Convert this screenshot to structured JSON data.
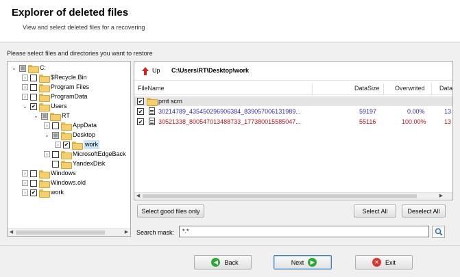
{
  "header": {
    "title": "Explorer of deleted files",
    "subtitle": "View and select deleted files for a recovering"
  },
  "instruction": "Please select files and directories you want to restore",
  "tree": {
    "items": [
      {
        "label": "C:",
        "state": "partial",
        "expander": "open"
      },
      {
        "label": "$Recycle.Bin",
        "state": "unchecked",
        "expander": "closed"
      },
      {
        "label": "Program Files",
        "state": "unchecked",
        "expander": "closed"
      },
      {
        "label": "ProgramData",
        "state": "unchecked",
        "expander": "closed"
      },
      {
        "label": "Users",
        "state": "checked",
        "expander": "open"
      },
      {
        "label": "RT",
        "state": "partial",
        "expander": "open"
      },
      {
        "label": "AppData",
        "state": "unchecked",
        "expander": "closed"
      },
      {
        "label": "Desktop",
        "state": "partial",
        "expander": "open"
      },
      {
        "label": "work",
        "state": "checked",
        "expander": "closed"
      },
      {
        "label": "MicrosoftEdgeBack",
        "state": "unchecked",
        "expander": "closed"
      },
      {
        "label": "YandexDisk",
        "state": "unchecked",
        "expander": "none"
      },
      {
        "label": "Windows",
        "state": "unchecked",
        "expander": "closed"
      },
      {
        "label": "Windows.old",
        "state": "unchecked",
        "expander": "closed"
      },
      {
        "label": "work",
        "state": "checked",
        "expander": "closed"
      }
    ]
  },
  "files": {
    "up_label": "Up",
    "path": "C:\\Users\\RT\\Desktop\\work",
    "columns": {
      "filename": "FileName",
      "datasize": "DataSize",
      "overwrited": "Overwrited",
      "date": "Data"
    },
    "rows": [
      {
        "name": "prnt scrn",
        "size": "",
        "over": "",
        "date": "",
        "type": "folder"
      },
      {
        "name": "30214789_435450296906384_839057006131989...",
        "size": "59197",
        "over": "0.00%",
        "date": "13",
        "type": "file",
        "color": "blue"
      },
      {
        "name": "30521338_800547013488733_177380015585047...",
        "size": "55116",
        "over": "100.00%",
        "date": "13",
        "type": "file",
        "color": "red"
      }
    ]
  },
  "buttons": {
    "select_good": "Select good files only",
    "select_all": "Select All",
    "deselect_all": "Deselect All",
    "back": "Back",
    "next": "Next",
    "exit": "Exit"
  },
  "search": {
    "label": "Search mask:",
    "value": "*.*"
  },
  "colors": {
    "blue_text": "#2d2aa6",
    "red_text": "#b3141b",
    "accent": "#3c7fb1"
  }
}
